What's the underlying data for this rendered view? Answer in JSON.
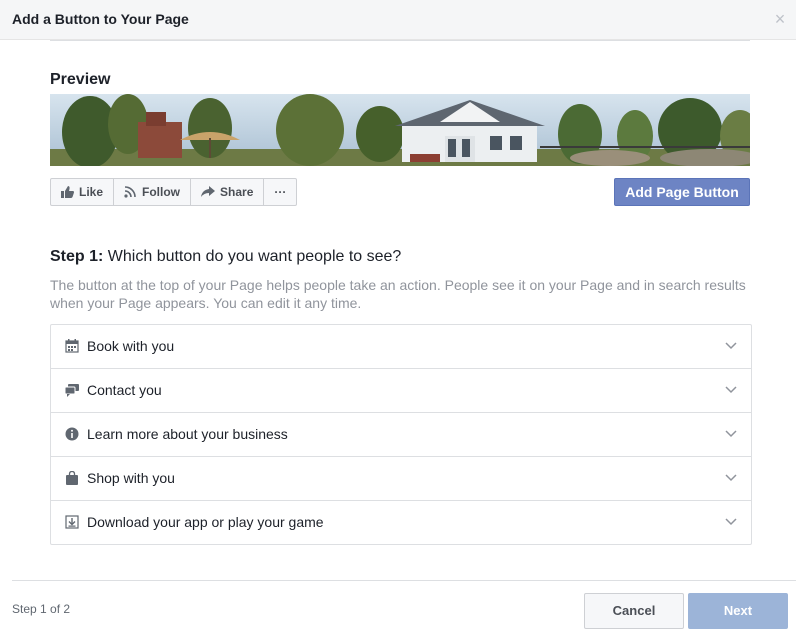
{
  "dialog": {
    "title": "Add a Button to Your Page",
    "close_icon": "close-icon"
  },
  "preview": {
    "label": "Preview",
    "actions": [
      {
        "label": "Like",
        "icon": "thumbs-up-icon"
      },
      {
        "label": "Follow",
        "icon": "rss-icon"
      },
      {
        "label": "Share",
        "icon": "share-arrow-icon"
      },
      {
        "label": "···",
        "icon": "more-icon"
      }
    ],
    "add_button_label": "Add Page Button"
  },
  "step": {
    "prefix": "Step 1:",
    "question": " Which button do you want people to see?",
    "description": "The button at the top of your Page helps people take an action. People see it on your Page and in search results when your Page appears. You can edit it any time."
  },
  "options": [
    {
      "label": "Book with you",
      "icon": "calendar-icon"
    },
    {
      "label": "Contact you",
      "icon": "chat-icon"
    },
    {
      "label": "Learn more about your business",
      "icon": "info-icon"
    },
    {
      "label": "Shop with you",
      "icon": "shopping-bag-icon"
    },
    {
      "label": "Download your app or play your game",
      "icon": "download-icon"
    }
  ],
  "footer": {
    "step_count": "Step 1 of 2",
    "cancel_label": "Cancel",
    "next_label": "Next"
  },
  "colors": {
    "primary": "#6d84c4",
    "next_disabled": "#9cb4d8"
  }
}
